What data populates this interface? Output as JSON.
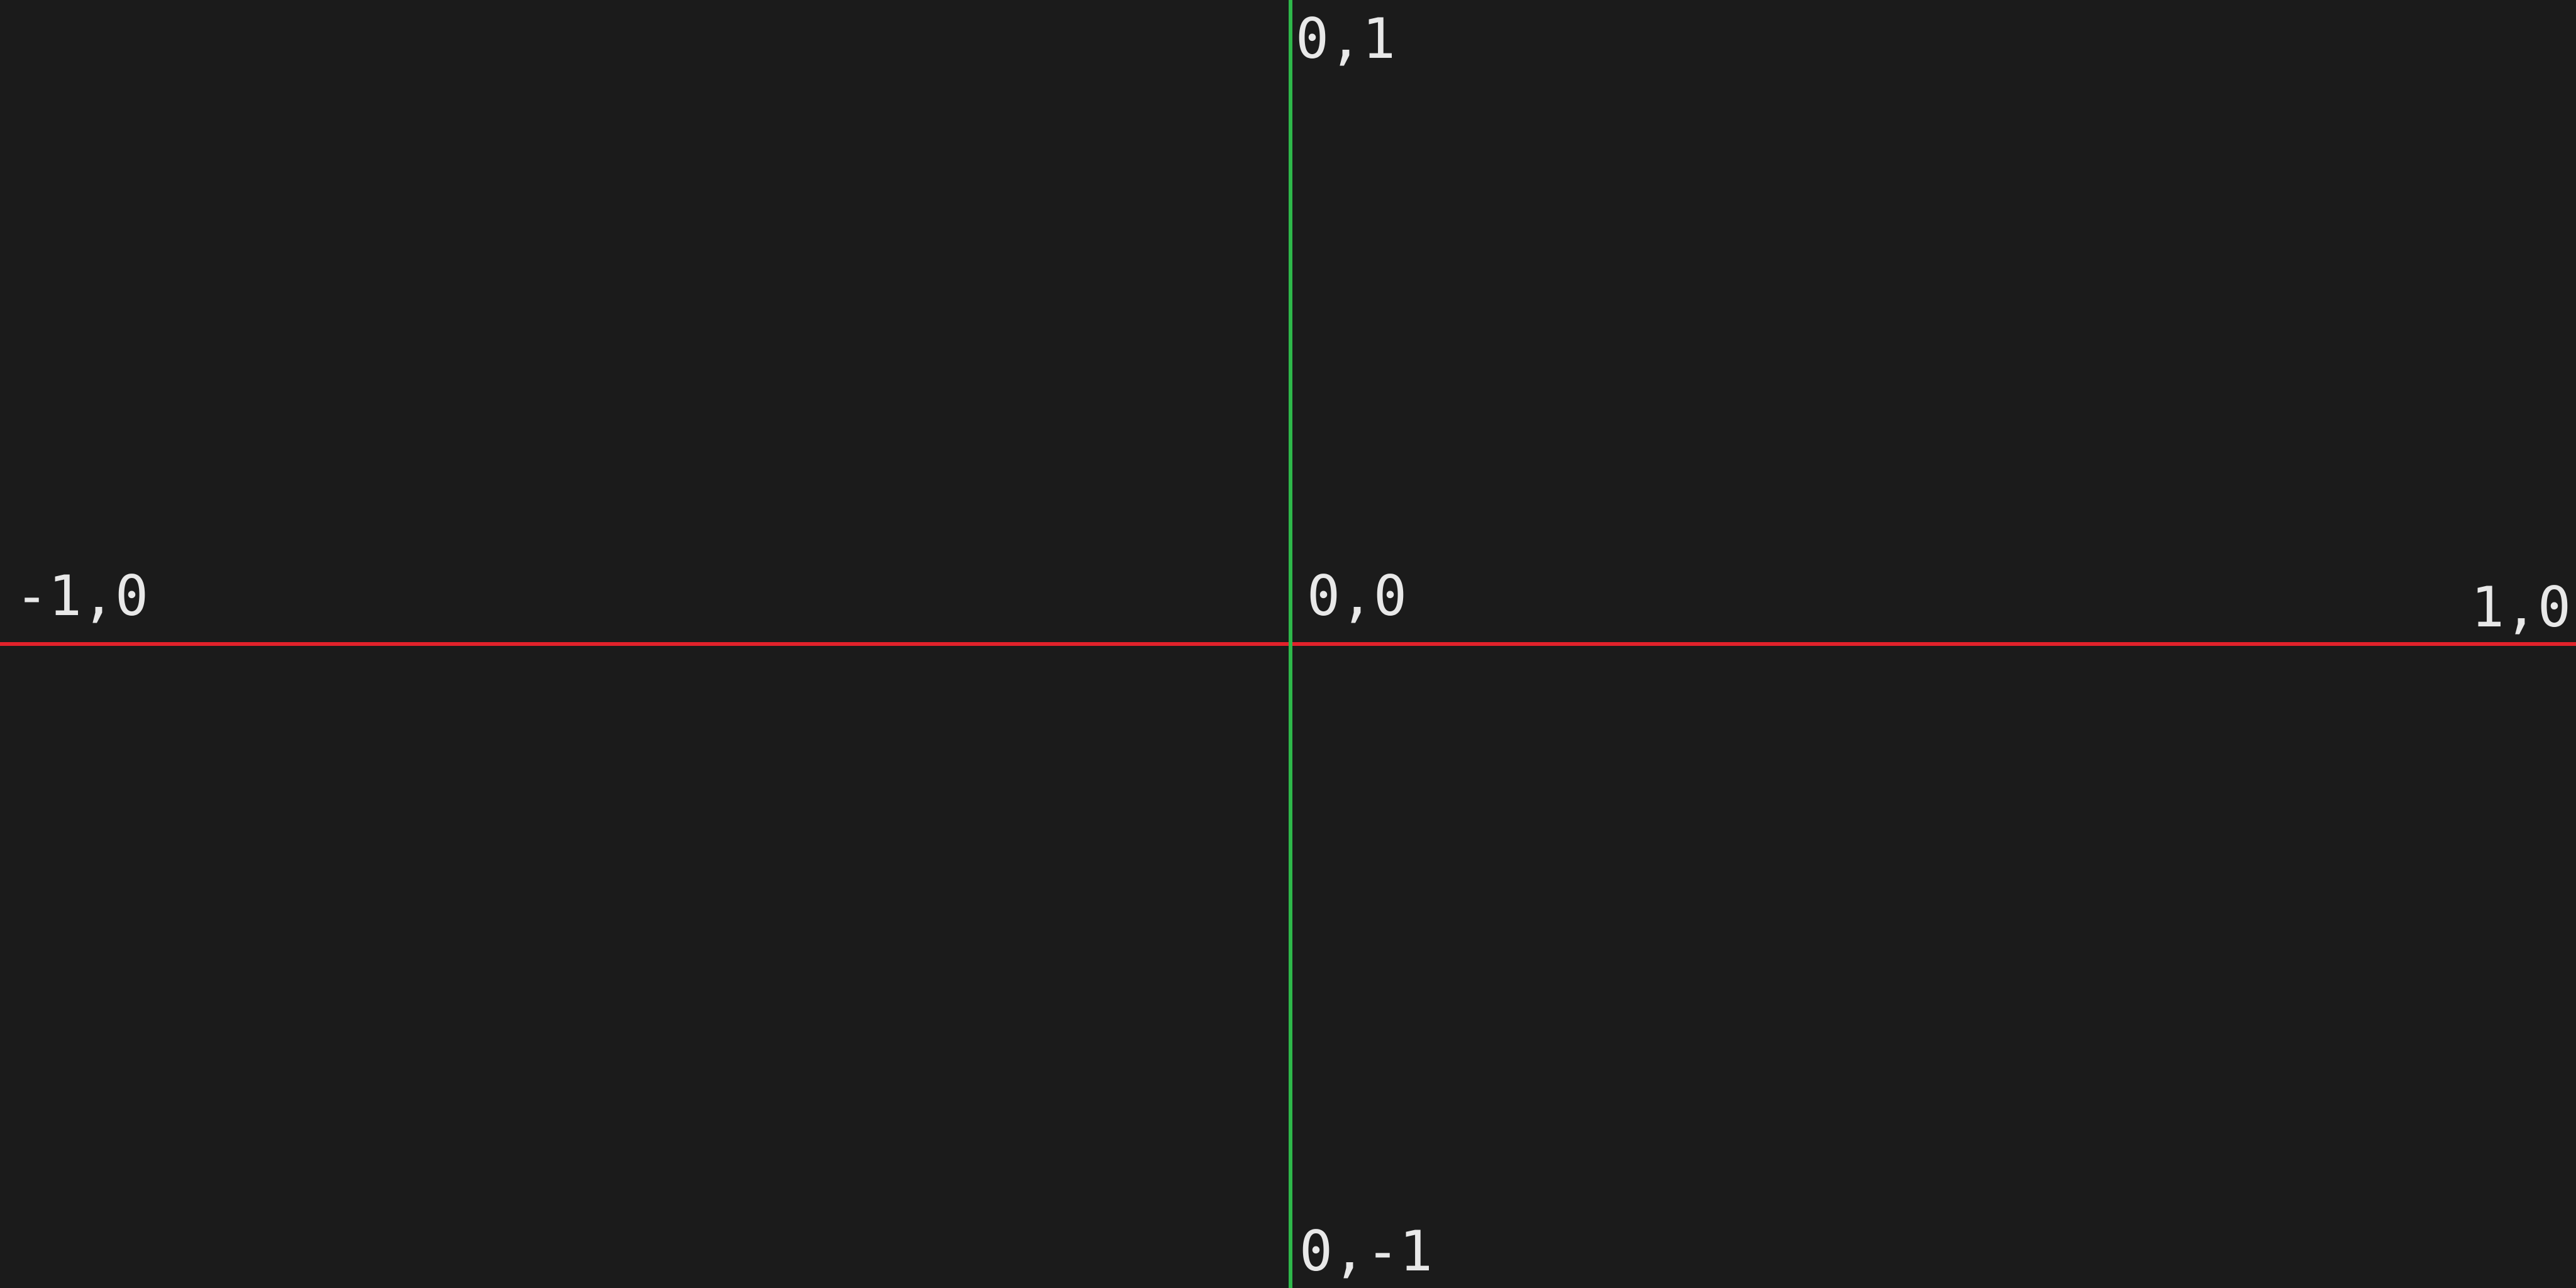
{
  "colors": {
    "background": "#1b1b1b",
    "x_axis": "#e2222b",
    "y_axis": "#2eb84a",
    "label": "#e8e8e8"
  },
  "labels": {
    "top": "0,1",
    "origin": "0,0",
    "left": "-1,0",
    "right": "1,0",
    "bottom": "0,-1"
  }
}
